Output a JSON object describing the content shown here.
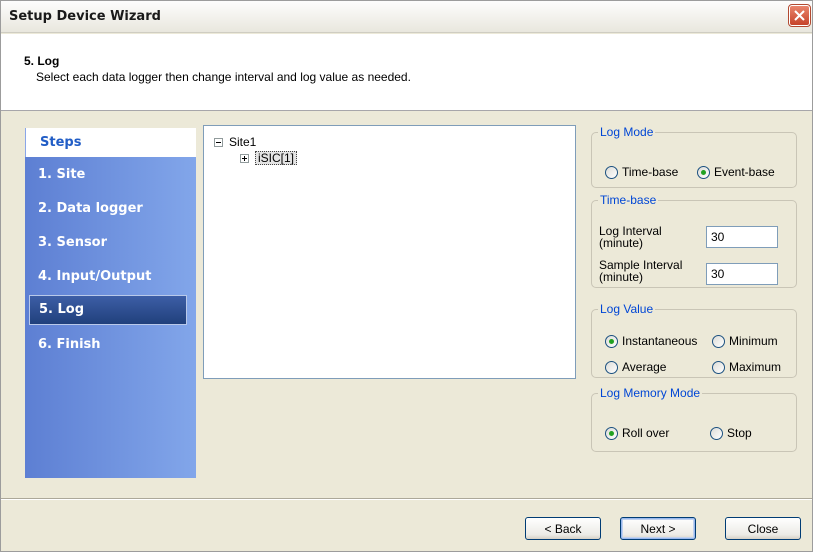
{
  "window": {
    "title": "Setup Device Wizard"
  },
  "header": {
    "step_title": "5. Log",
    "step_description": "Select each data logger then change interval and log value as needed."
  },
  "steps": {
    "heading": "Steps",
    "items": [
      {
        "label": "1. Site",
        "active": false
      },
      {
        "label": "2. Data logger",
        "active": false
      },
      {
        "label": "3. Sensor",
        "active": false
      },
      {
        "label": "4. Input/Output",
        "active": false
      },
      {
        "label": "5. Log",
        "active": true
      },
      {
        "label": "6. Finish",
        "active": false
      }
    ]
  },
  "tree": {
    "root": {
      "label": "Site1",
      "expanded": true
    },
    "child": {
      "label": "iSIC[1]",
      "expanded": false,
      "selected": true
    }
  },
  "log_mode": {
    "legend": "Log Mode",
    "options": [
      {
        "label": "Time-base",
        "checked": false
      },
      {
        "label": "Event-base",
        "checked": true
      }
    ]
  },
  "time_base": {
    "legend": "Time-base",
    "log_interval": {
      "label_1": "Log Interval",
      "label_2": "(minute)",
      "value": "30"
    },
    "sample_interval": {
      "label_1": "Sample Interval",
      "label_2": "(minute)",
      "value": "30"
    }
  },
  "log_value": {
    "legend": "Log Value",
    "options": [
      {
        "label": "Instantaneous",
        "checked": true
      },
      {
        "label": "Minimum",
        "checked": false
      },
      {
        "label": "Average",
        "checked": false
      },
      {
        "label": "Maximum",
        "checked": false
      }
    ]
  },
  "log_memory_mode": {
    "legend": "Log Memory Mode",
    "options": [
      {
        "label": "Roll over",
        "checked": true
      },
      {
        "label": "Stop",
        "checked": false
      }
    ]
  },
  "buttons": {
    "back": "< Back",
    "next": "Next >",
    "close": "Close"
  }
}
